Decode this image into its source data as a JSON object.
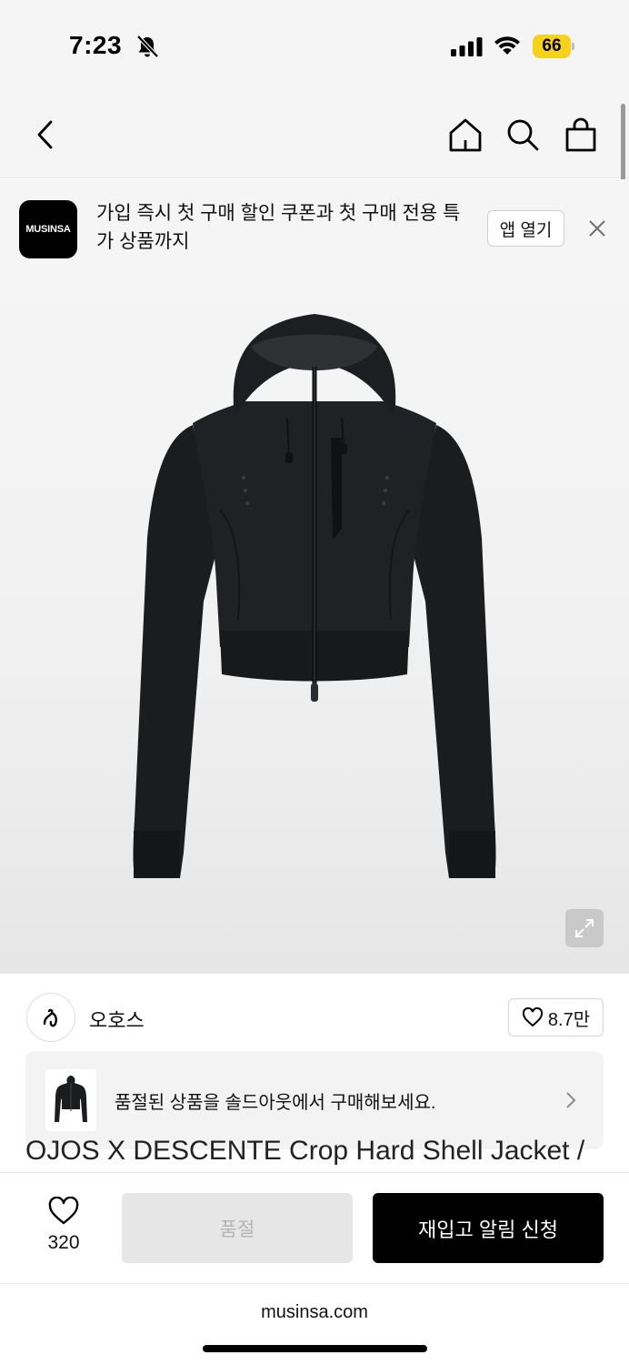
{
  "status_bar": {
    "time": "7:23",
    "battery": "66"
  },
  "banner": {
    "logo": "MUSINSA",
    "text": "가입 즉시 첫 구매 할인 쿠폰과 첫 구매 전용 특가 상품까지",
    "open_label": "앱 열기"
  },
  "brand": {
    "name": "오호스",
    "likes": "8.7만"
  },
  "soldout_notice": {
    "text": "품절된 상품을 솔드아웃에서 구매해보세요."
  },
  "product": {
    "title": "OJOS X DESCENTE Crop Hard Shell Jacket /"
  },
  "action_bar": {
    "wish_count": "320",
    "soldout_label": "품절",
    "restock_label": "재입고 알림 신청"
  },
  "browser": {
    "url": "musinsa.com"
  },
  "icons": {
    "back": "chevron-left-icon",
    "home": "home-icon",
    "search": "search-icon",
    "cart": "shopping-bag-icon",
    "close": "close-icon",
    "expand": "expand-icon",
    "heart": "heart-icon",
    "chevron": "chevron-right-icon"
  },
  "colors": {
    "accent": "#000000",
    "battery": "#f7d21c",
    "disabled": "#e6e6e6"
  }
}
